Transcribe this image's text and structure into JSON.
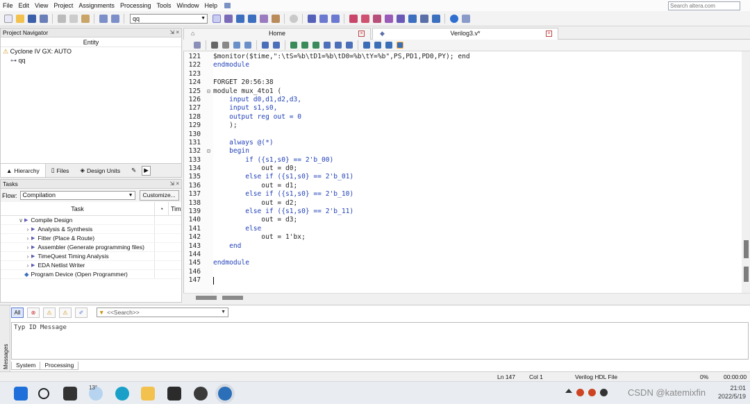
{
  "menu": {
    "items": [
      "File",
      "Edit",
      "View",
      "Project",
      "Assignments",
      "Processing",
      "Tools",
      "Window",
      "Help"
    ],
    "search_placeholder": "Search altera.com"
  },
  "toolbar": {
    "entity_value": "qq"
  },
  "project_navigator": {
    "title": "Project Navigator",
    "controls": "⇲ ×",
    "column_header": "Entity",
    "device": "Cyclone IV GX: AUTO",
    "top_entity": "qq",
    "tabs": [
      "Hierarchy",
      "Files",
      "Design Units"
    ]
  },
  "tasks": {
    "title": "Tasks",
    "controls": "⇲ ×",
    "flow_label": "Flow:",
    "flow_value": "Compilation",
    "customize_label": "Customize...",
    "col_task": "Task",
    "col_time": "Tim",
    "rows": [
      "Compile Design",
      "Analysis & Synthesis",
      "Fitter (Place & Route)",
      "Assembler (Generate programming files)",
      "TimeQuest Timing Analysis",
      "EDA Netlist Writer",
      "Program Device (Open Programmer)"
    ]
  },
  "editor": {
    "tabs": [
      "Home",
      "Verilog3.v*"
    ],
    "line_numbers": [
      "121",
      "122",
      "123",
      "124",
      "125",
      "126",
      "127",
      "128",
      "129",
      "130",
      "131",
      "132",
      "133",
      "134",
      "135",
      "136",
      "137",
      "138",
      "139",
      "140",
      "141",
      "142",
      "143",
      "144",
      "145",
      "146",
      "147"
    ],
    "lines": [
      "$monitor($time,\":\\tS=%b\\tD1=%b\\tD0=%b\\tY=%b\",PS,PD1,PD0,PY); end",
      "endmodule",
      "",
      "FORGET 20:56:38",
      "module mux_4to1 (",
      "    input d0,d1,d2,d3,",
      "    input s1,s0,",
      "    output reg out = 0",
      "    );",
      "",
      "    always @(*)",
      "    begin",
      "        if ({s1,s0} == 2'b_00)",
      "            out = d0;",
      "        else if ({s1,s0} == 2'b_01)",
      "            out = d1;",
      "        else if ({s1,s0} == 2'b_10)",
      "            out = d2;",
      "        else if ({s1,s0} == 2'b_11)",
      "            out = d3;",
      "        else",
      "            out = 1'bx;",
      "    end",
      "",
      "endmodule",
      "",
      ""
    ]
  },
  "messages": {
    "side_label": "Messages",
    "filter_all": "All",
    "search_placeholder": "<<Search>>",
    "columns": "Typ   ID   Message",
    "tabs": [
      "System",
      "Processing"
    ]
  },
  "status": {
    "position": "Ln 147",
    "column": "Col 1",
    "file_type": "Verilog HDL File",
    "progress": "0%",
    "elapsed": "00:00:00"
  },
  "taskbar": {
    "weather": "13°",
    "time": "21:01",
    "date": "2022/5/19",
    "watermark": "CSDN @katemixfin"
  }
}
